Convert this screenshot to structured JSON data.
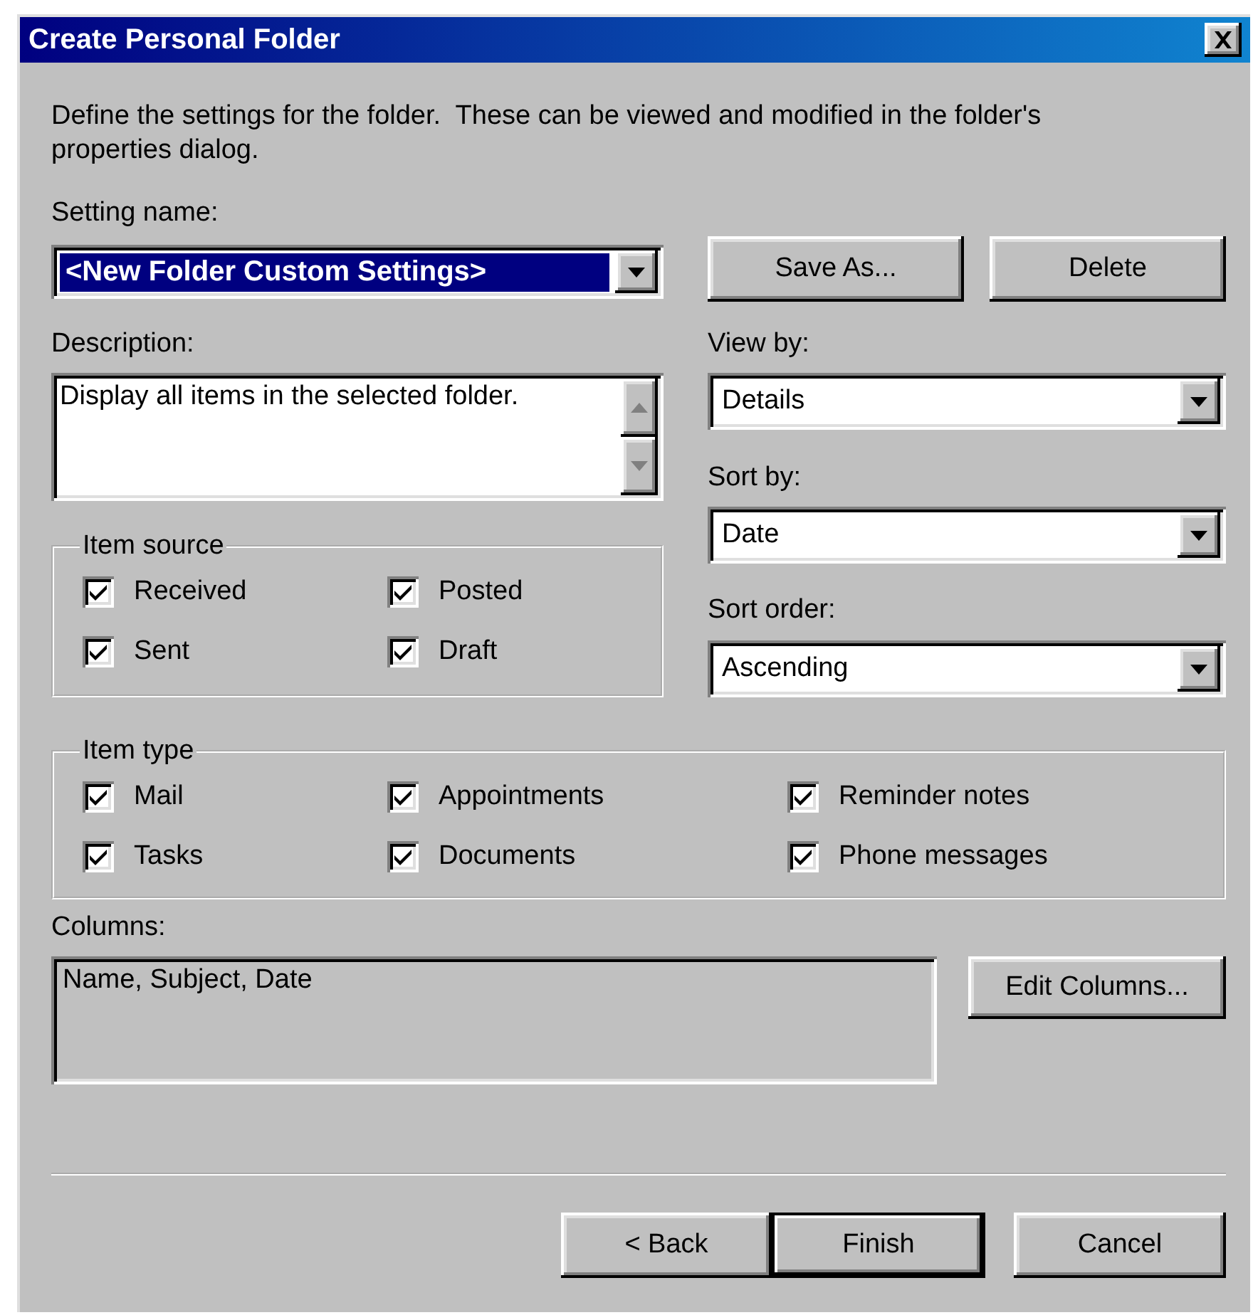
{
  "window": {
    "title": "Create Personal Folder"
  },
  "intro": "Define the settings for the folder.  These can be viewed and modified in the folder's properties dialog.",
  "setting_name": {
    "label": "Setting name:",
    "value": "<New Folder Custom Settings>",
    "highlighted": true
  },
  "setting_buttons": [
    {
      "label": "Save As..."
    },
    {
      "label": "Delete"
    }
  ],
  "description": {
    "label": "Description:",
    "value": "Display all items in the selected folder."
  },
  "dropdowns": [
    {
      "label": "View by:",
      "value": "Details"
    },
    {
      "label": "Sort by:",
      "value": "Date"
    },
    {
      "label": "Sort order:",
      "value": "Ascending"
    }
  ],
  "item_source": {
    "title": "Item source",
    "items": [
      {
        "label": "Received",
        "checked": true
      },
      {
        "label": "Posted",
        "checked": true
      },
      {
        "label": "Sent",
        "checked": true
      },
      {
        "label": "Draft",
        "checked": true
      }
    ]
  },
  "item_type": {
    "title": "Item type",
    "items": [
      {
        "label": "Mail",
        "checked": true
      },
      {
        "label": "Appointments",
        "checked": true
      },
      {
        "label": "Reminder notes",
        "checked": true
      },
      {
        "label": "Tasks",
        "checked": true
      },
      {
        "label": "Documents",
        "checked": true
      },
      {
        "label": "Phone messages",
        "checked": true
      }
    ]
  },
  "columns": {
    "label": "Columns:",
    "value": "Name, Subject, Date",
    "button": {
      "label": "Edit Columns..."
    }
  },
  "footer_buttons": [
    {
      "label": "< Back",
      "default": false
    },
    {
      "label": "Finish",
      "default": true
    },
    {
      "label": "Cancel",
      "default": false
    }
  ]
}
